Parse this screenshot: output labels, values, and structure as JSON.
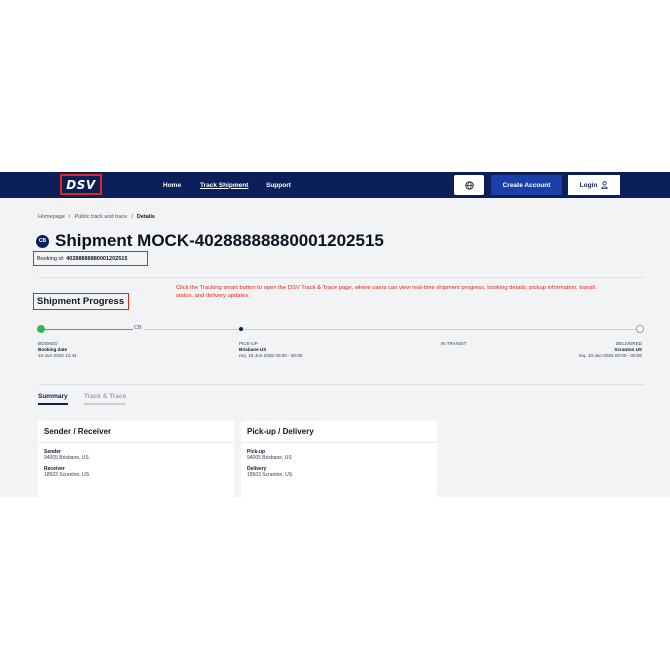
{
  "header": {
    "logo": "DSV",
    "nav": {
      "home": "Home",
      "track_shipment": "Track Shipment",
      "support": "Support"
    },
    "create_account": "Create Account",
    "login": "Login",
    "colors": {
      "header_bg": "#0b2059",
      "accent": "#1a3fa8",
      "highlight": "#e1261c"
    }
  },
  "breadcrumb": {
    "home": "Homepage",
    "sep1": "/",
    "public": "Public track and trace",
    "sep2": "/",
    "current": "Details"
  },
  "shipment": {
    "icon_text": "CB",
    "title": "Shipment MOCK-40288888880001202515",
    "booking_label": "Booking id:",
    "booking_id": "40288888880001202515"
  },
  "progress": {
    "heading": "Shipment Progress",
    "annotation": "Click the Tracking smart button to open the DSV Track & Trace page, where users can view real-time shipment progress, booking details, pickup information, transit status, and delivery updates.",
    "truck_icon_text": "CB",
    "stages": {
      "booked": {
        "label": "BOOKED",
        "sub_title": "Booking date",
        "sub_value": "10-Jun-2026 12:44"
      },
      "pickup": {
        "label": "PICK-UP",
        "sub_title": "Brisbane US",
        "sub_value": "req. 10-Jun-2026 00:00 - 00:00"
      },
      "transit": {
        "label": "IN TRANSIT"
      },
      "delivered": {
        "label": "DELIVERED",
        "sub_title": "Scranton US",
        "sub_value": "req. 10-Jun-2026 00:00 - 00:00"
      }
    }
  },
  "tabs": {
    "summary": "Summary",
    "track_trace": "Track & Trace"
  },
  "cards": {
    "sender_receiver": {
      "title": "Sender / Receiver",
      "sender_label": "Sender",
      "sender_value": "94005 Brisbane, US",
      "receiver_label": "Receiver",
      "receiver_value": "18503 Scranton, US"
    },
    "pickup_delivery": {
      "title": "Pick-up / Delivery",
      "pickup_label": "Pick-up",
      "pickup_value": "94005 Brisbane, US",
      "delivery_label": "Delivery",
      "delivery_value": "18503 Scranton, US"
    }
  },
  "icons": {
    "globe": "globe-icon",
    "user": "user-icon",
    "truck": "truck-icon"
  }
}
